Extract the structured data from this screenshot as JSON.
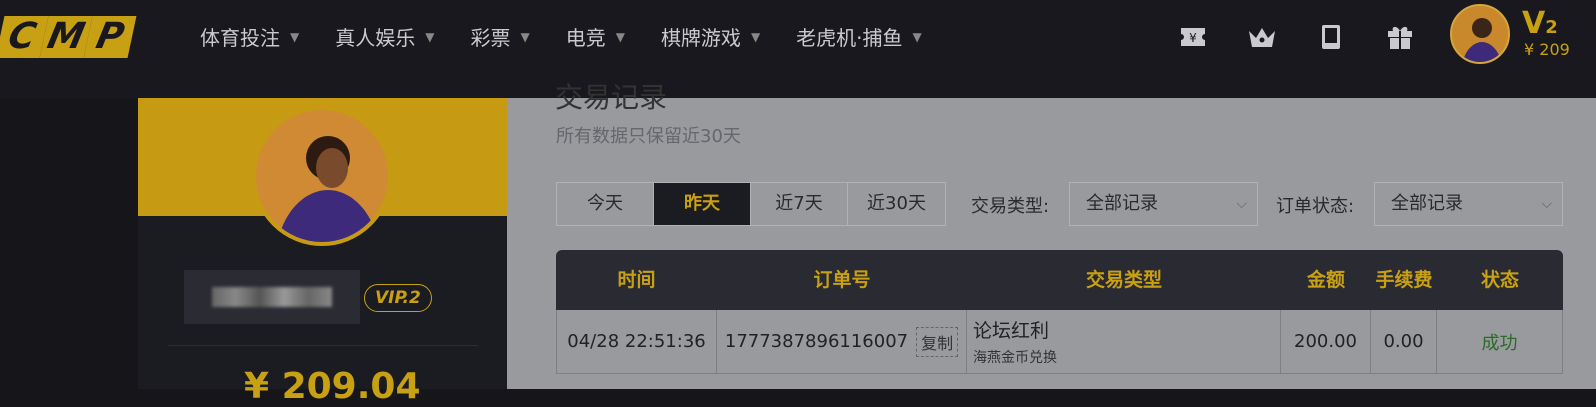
{
  "logo": {
    "letters": [
      "C",
      "M",
      "P"
    ]
  },
  "nav": {
    "items": [
      {
        "label": "体育投注"
      },
      {
        "label": "真人娱乐"
      },
      {
        "label": "彩票"
      },
      {
        "label": "电竞"
      },
      {
        "label": "棋牌游戏"
      },
      {
        "label": "老虎机·捕鱼"
      }
    ]
  },
  "top_icons": [
    "ticket-icon",
    "crown-icon",
    "tablet-icon",
    "gift-icon"
  ],
  "user": {
    "vip_level": "V2",
    "vip_level_main": "V",
    "vip_level_num": "2",
    "balance_top": "¥ 209",
    "vip_badge": "VIP.2",
    "balance": "¥ 209.04"
  },
  "main": {
    "title": "交易记录",
    "note": "所有数据只保留近30天",
    "date_filters": [
      "今天",
      "昨天",
      "近7天",
      "近30天"
    ],
    "active_filter": "昨天",
    "tx_type_label": "交易类型:",
    "tx_type_value": "全部记录",
    "order_status_label": "订单状态:",
    "order_status_value": "全部记录"
  },
  "table": {
    "headers": [
      "时间",
      "订单号",
      "交易类型",
      "金额",
      "手续费",
      "状态"
    ],
    "rows": [
      {
        "time": "04/28 22:51:36",
        "order_no": "1777387896116007",
        "copy": "复制",
        "type": "论坛红利",
        "sub": "海燕金币兑换",
        "amount": "200.00",
        "fee": "0.00",
        "status": "成功"
      }
    ]
  },
  "colors": {
    "accent": "#c8a013",
    "success": "#2a6b2a",
    "topbar": "#18181e"
  }
}
